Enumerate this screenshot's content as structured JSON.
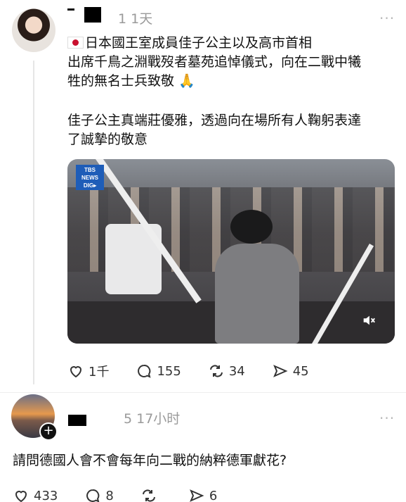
{
  "post": {
    "time": "1 1天",
    "more": "···",
    "text_line1": "日本國王室成員佳子公主以及高市首相",
    "text_line2": "出席千鳥之淵戰歿者墓苑追悼儀式，向在二戰中犧",
    "text_line3": "牲的無名士兵致敬 🙏",
    "text_line4": "佳子公主真端莊優雅，透過向在場所有人鞠躬表達",
    "text_line5": "了誠摯的敬意",
    "media": {
      "logo_line1": "TBS",
      "logo_line2": "NEWS",
      "logo_line3": "DIG▸"
    },
    "stats": {
      "likes": "1千",
      "comments": "155",
      "reposts": "34",
      "shares": "45"
    }
  },
  "reply": {
    "time": "5 17小时",
    "more": "···",
    "text": "請問德國人會不會每年向二戰的納粹德軍獻花?",
    "stats": {
      "likes": "433",
      "comments": "8",
      "reposts": "",
      "shares": "6"
    }
  }
}
